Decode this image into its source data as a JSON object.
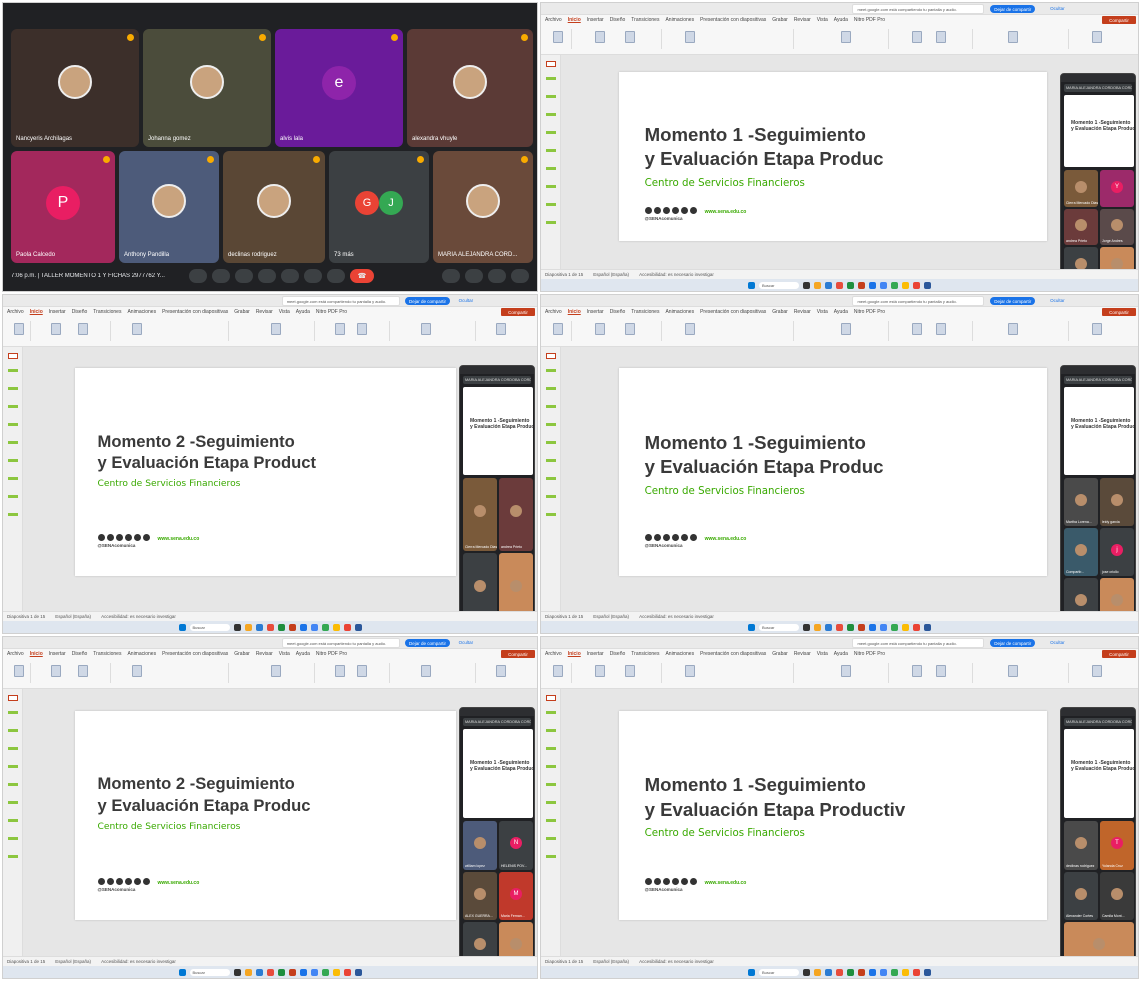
{
  "colors": {
    "meet_bg": "#202124",
    "sena_green": "#39a900",
    "ppt_accent": "#c43e1c",
    "meet_blue": "#1a73e8",
    "hangup_red": "#ea4335"
  },
  "meet_grid": {
    "participants": [
      {
        "name": "Nancyeris Archilagas",
        "color": "#3c2f2a"
      },
      {
        "name": "Johanna gomez",
        "color": "#4b4c3b"
      },
      {
        "name": "alvis lala",
        "color": "#6a1b9a",
        "initial": "e"
      },
      {
        "name": "alexandra vhuyle",
        "color": "#5b3a36"
      },
      {
        "name": "Paola Calcedo",
        "color": "#a3285c",
        "initial": "P"
      },
      {
        "name": "Anthony Pandilla",
        "color": "#4d5b7a"
      },
      {
        "name": "declinas rodriguez",
        "color": "#5a4735"
      },
      {
        "name": "73 más",
        "color": "#3c4043",
        "initials": [
          "G",
          "J"
        ]
      },
      {
        "name": "MARIA ALEJANDRA CORD...",
        "color": "#6a4a3a"
      }
    ],
    "meeting_label": "7:06 p.m.  |  TALLER MOMENTO 1 Y FICHAS 2977762 Y...",
    "hangup_label": "☎"
  },
  "ppt": {
    "tabs": [
      "Archivo",
      "Inicio",
      "Insertar",
      "Diseño",
      "Transiciones",
      "Animaciones",
      "Presentación con diapositivas",
      "Grabar",
      "Revisar",
      "Vista",
      "Ayuda",
      "Nitro PDF Pro"
    ],
    "active_tab": "Inicio",
    "share_notice": "meet.google.com está compartiendo tu pantalla y audio.",
    "stop_sharing": "Dejar de compartir",
    "hide": "Ocultar",
    "compartir": "Compartir",
    "status_slide": "Diapositiva 1 de 15",
    "status_lang": "Español (España)",
    "status_access": "Accesibilidad: es necesario investigar",
    "search": "Buscar",
    "preview_title_1": "Momento 1 -Seguimiento",
    "preview_title_2": "y Evaluación Etapa Productiva",
    "mini_presenter": "MARIA ALEJANDRA CORDOBA CORDOBA (Tú, presen..."
  },
  "slides": [
    {
      "line1": "Momento 1 -Seguimiento",
      "line2": "y Evaluación Etapa Produc",
      "sub": "Centro de Servicios Financieros",
      "handle": "@SENAcomunica",
      "url": "www.sena.edu.co"
    },
    {
      "line1": "Momento 2 -Seguimiento",
      "line2": "y Evaluación Etapa Product",
      "sub": "Centro de Servicios Financieros",
      "handle": "@SENAcomunica",
      "url": "www.sena.edu.co"
    },
    {
      "line1": "Momento 1 -Seguimiento",
      "line2": "y Evaluación Etapa Produc",
      "sub": "Centro de Servicios Financieros",
      "handle": "@SENAcomunica",
      "url": "www.sena.edu.co"
    },
    {
      "line1": "Momento 2 -Seguimiento",
      "line2": "y Evaluación Etapa Produc",
      "sub": "Centro de Servicios Financieros",
      "handle": "@SENAcomunica",
      "url": "www.sena.edu.co"
    },
    {
      "line1": "Momento 1 -Seguimiento",
      "line2": "y Evaluación Etapa Productiv",
      "sub": "Centro de Servicios Financieros",
      "handle": "@SENAcomunica",
      "url": "www.sena.edu.co"
    }
  ],
  "mini_tiles": [
    [
      {
        "name": "Cierra Mercado Dias",
        "c": "#7a5a3a"
      },
      {
        "name": "",
        "c": "#9c2a6a",
        "i": "Y"
      },
      {
        "name": "andrea Prieto",
        "c": "#6b3b3b"
      },
      {
        "name": "Jorge Andres",
        "c": "#5a4a4a"
      },
      {
        "name": "72 más",
        "c": "#3c4043"
      },
      {
        "name": "",
        "c": "#c98a5a"
      }
    ],
    [
      {
        "name": "Cierra Mercado Dias",
        "c": "#7a5a3a"
      },
      {
        "name": "andrea Prieto",
        "c": "#6b3b3b"
      },
      {
        "name": "72 más",
        "c": "#3c4043"
      },
      {
        "name": "",
        "c": "#c98a5a"
      }
    ],
    [
      {
        "name": "Martha Lorena...",
        "c": "#4a4a4a"
      },
      {
        "name": "leidy garcia",
        "c": "#5a4a3a"
      },
      {
        "name": "Compartir...",
        "c": "#3a5a6a"
      },
      {
        "name": "jose criollo",
        "c": "#3c4043",
        "i": "j"
      },
      {
        "name": "74 más",
        "c": "#3c4043"
      },
      {
        "name": "",
        "c": "#c98a5a"
      }
    ],
    [
      {
        "name": "william lopez",
        "c": "#4d5b7a"
      },
      {
        "name": "HELENIS POV...",
        "c": "#3c4043",
        "i": "N"
      },
      {
        "name": "ALEX GUERRA...",
        "c": "#5a4a3a"
      },
      {
        "name": "Maria Fernan...",
        "c": "#c0392b",
        "i": "M"
      },
      {
        "name": "73 más",
        "c": "#3c4043"
      },
      {
        "name": "",
        "c": "#c98a5a"
      }
    ],
    [
      {
        "name": "declinas rodriguez",
        "c": "#4a4a4a"
      },
      {
        "name": "Yolanda Cruz",
        "c": "#c0652a",
        "i": "T"
      },
      {
        "name": "Alexander Cortes",
        "c": "#3c4043"
      },
      {
        "name": "Camila Mont...",
        "c": "#3a3a3a"
      },
      {
        "name": "MARIA ALEJANDRA CORDOBA C...",
        "c": "#c98a5a"
      }
    ]
  ]
}
